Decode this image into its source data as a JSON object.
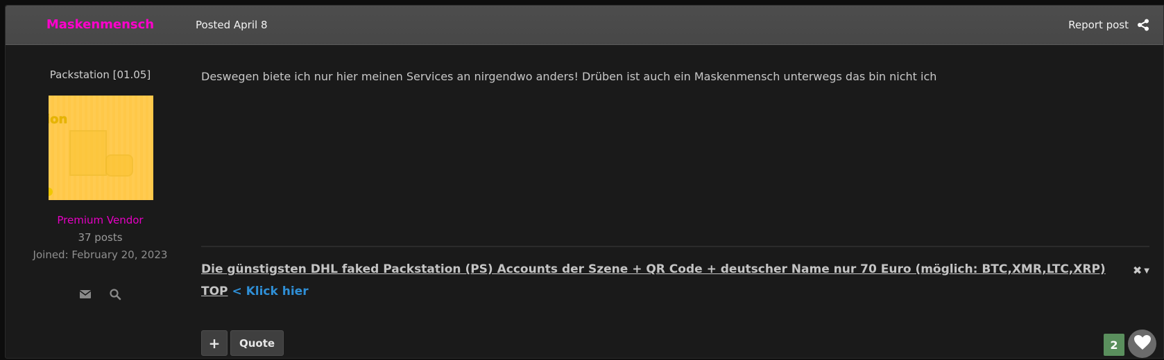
{
  "header": {
    "author": "Maskenmensch",
    "posted": "Posted April 8",
    "report_label": "Report post",
    "share_icon": "share-icon"
  },
  "author_panel": {
    "group_title": "Packstation [01.05]",
    "avatar_text": "ion",
    "rank": "Premium Vendor",
    "posts": "37 posts",
    "joined": "Joined: February 20, 2023",
    "icons": [
      "envelope-icon",
      "search-icon"
    ]
  },
  "post": {
    "message": "Deswegen biete ich nur hier meinen Services an nirgendwo anders! Drüben ist auch ein Maskenmensch unterwegs das bin nicht ich"
  },
  "signature": {
    "link_text": "Die günstigsten DHL faked Packstation (PS) Accounts der Szene + QR Code + deutscher Name nur 70 Euro (möglich: BTC,XMR,LTC,XRP)",
    "top_text": "TOP",
    "klick_text": "< Klick hier",
    "close_glyph": "✖",
    "caret_glyph": "▼"
  },
  "actions": {
    "plus_label": "+",
    "quote_label": "Quote",
    "reputation_count": "2"
  },
  "colors": {
    "author": "#ff00cc",
    "rank": "#e600c4",
    "link_blue": "#2f8fd6",
    "reputation_green": "#5a8f5d"
  }
}
